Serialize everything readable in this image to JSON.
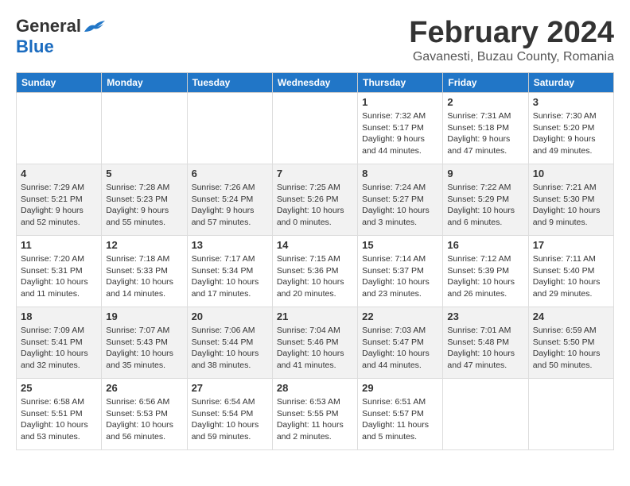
{
  "header": {
    "logo_general": "General",
    "logo_blue": "Blue",
    "month_title": "February 2024",
    "subtitle": "Gavanesti, Buzau County, Romania"
  },
  "weekdays": [
    "Sunday",
    "Monday",
    "Tuesday",
    "Wednesday",
    "Thursday",
    "Friday",
    "Saturday"
  ],
  "weeks": [
    [
      {
        "day": "",
        "sunrise": "",
        "sunset": "",
        "daylight": ""
      },
      {
        "day": "",
        "sunrise": "",
        "sunset": "",
        "daylight": ""
      },
      {
        "day": "",
        "sunrise": "",
        "sunset": "",
        "daylight": ""
      },
      {
        "day": "",
        "sunrise": "",
        "sunset": "",
        "daylight": ""
      },
      {
        "day": "1",
        "sunrise": "Sunrise: 7:32 AM",
        "sunset": "Sunset: 5:17 PM",
        "daylight": "Daylight: 9 hours and 44 minutes."
      },
      {
        "day": "2",
        "sunrise": "Sunrise: 7:31 AM",
        "sunset": "Sunset: 5:18 PM",
        "daylight": "Daylight: 9 hours and 47 minutes."
      },
      {
        "day": "3",
        "sunrise": "Sunrise: 7:30 AM",
        "sunset": "Sunset: 5:20 PM",
        "daylight": "Daylight: 9 hours and 49 minutes."
      }
    ],
    [
      {
        "day": "4",
        "sunrise": "Sunrise: 7:29 AM",
        "sunset": "Sunset: 5:21 PM",
        "daylight": "Daylight: 9 hours and 52 minutes."
      },
      {
        "day": "5",
        "sunrise": "Sunrise: 7:28 AM",
        "sunset": "Sunset: 5:23 PM",
        "daylight": "Daylight: 9 hours and 55 minutes."
      },
      {
        "day": "6",
        "sunrise": "Sunrise: 7:26 AM",
        "sunset": "Sunset: 5:24 PM",
        "daylight": "Daylight: 9 hours and 57 minutes."
      },
      {
        "day": "7",
        "sunrise": "Sunrise: 7:25 AM",
        "sunset": "Sunset: 5:26 PM",
        "daylight": "Daylight: 10 hours and 0 minutes."
      },
      {
        "day": "8",
        "sunrise": "Sunrise: 7:24 AM",
        "sunset": "Sunset: 5:27 PM",
        "daylight": "Daylight: 10 hours and 3 minutes."
      },
      {
        "day": "9",
        "sunrise": "Sunrise: 7:22 AM",
        "sunset": "Sunset: 5:29 PM",
        "daylight": "Daylight: 10 hours and 6 minutes."
      },
      {
        "day": "10",
        "sunrise": "Sunrise: 7:21 AM",
        "sunset": "Sunset: 5:30 PM",
        "daylight": "Daylight: 10 hours and 9 minutes."
      }
    ],
    [
      {
        "day": "11",
        "sunrise": "Sunrise: 7:20 AM",
        "sunset": "Sunset: 5:31 PM",
        "daylight": "Daylight: 10 hours and 11 minutes."
      },
      {
        "day": "12",
        "sunrise": "Sunrise: 7:18 AM",
        "sunset": "Sunset: 5:33 PM",
        "daylight": "Daylight: 10 hours and 14 minutes."
      },
      {
        "day": "13",
        "sunrise": "Sunrise: 7:17 AM",
        "sunset": "Sunset: 5:34 PM",
        "daylight": "Daylight: 10 hours and 17 minutes."
      },
      {
        "day": "14",
        "sunrise": "Sunrise: 7:15 AM",
        "sunset": "Sunset: 5:36 PM",
        "daylight": "Daylight: 10 hours and 20 minutes."
      },
      {
        "day": "15",
        "sunrise": "Sunrise: 7:14 AM",
        "sunset": "Sunset: 5:37 PM",
        "daylight": "Daylight: 10 hours and 23 minutes."
      },
      {
        "day": "16",
        "sunrise": "Sunrise: 7:12 AM",
        "sunset": "Sunset: 5:39 PM",
        "daylight": "Daylight: 10 hours and 26 minutes."
      },
      {
        "day": "17",
        "sunrise": "Sunrise: 7:11 AM",
        "sunset": "Sunset: 5:40 PM",
        "daylight": "Daylight: 10 hours and 29 minutes."
      }
    ],
    [
      {
        "day": "18",
        "sunrise": "Sunrise: 7:09 AM",
        "sunset": "Sunset: 5:41 PM",
        "daylight": "Daylight: 10 hours and 32 minutes."
      },
      {
        "day": "19",
        "sunrise": "Sunrise: 7:07 AM",
        "sunset": "Sunset: 5:43 PM",
        "daylight": "Daylight: 10 hours and 35 minutes."
      },
      {
        "day": "20",
        "sunrise": "Sunrise: 7:06 AM",
        "sunset": "Sunset: 5:44 PM",
        "daylight": "Daylight: 10 hours and 38 minutes."
      },
      {
        "day": "21",
        "sunrise": "Sunrise: 7:04 AM",
        "sunset": "Sunset: 5:46 PM",
        "daylight": "Daylight: 10 hours and 41 minutes."
      },
      {
        "day": "22",
        "sunrise": "Sunrise: 7:03 AM",
        "sunset": "Sunset: 5:47 PM",
        "daylight": "Daylight: 10 hours and 44 minutes."
      },
      {
        "day": "23",
        "sunrise": "Sunrise: 7:01 AM",
        "sunset": "Sunset: 5:48 PM",
        "daylight": "Daylight: 10 hours and 47 minutes."
      },
      {
        "day": "24",
        "sunrise": "Sunrise: 6:59 AM",
        "sunset": "Sunset: 5:50 PM",
        "daylight": "Daylight: 10 hours and 50 minutes."
      }
    ],
    [
      {
        "day": "25",
        "sunrise": "Sunrise: 6:58 AM",
        "sunset": "Sunset: 5:51 PM",
        "daylight": "Daylight: 10 hours and 53 minutes."
      },
      {
        "day": "26",
        "sunrise": "Sunrise: 6:56 AM",
        "sunset": "Sunset: 5:53 PM",
        "daylight": "Daylight: 10 hours and 56 minutes."
      },
      {
        "day": "27",
        "sunrise": "Sunrise: 6:54 AM",
        "sunset": "Sunset: 5:54 PM",
        "daylight": "Daylight: 10 hours and 59 minutes."
      },
      {
        "day": "28",
        "sunrise": "Sunrise: 6:53 AM",
        "sunset": "Sunset: 5:55 PM",
        "daylight": "Daylight: 11 hours and 2 minutes."
      },
      {
        "day": "29",
        "sunrise": "Sunrise: 6:51 AM",
        "sunset": "Sunset: 5:57 PM",
        "daylight": "Daylight: 11 hours and 5 minutes."
      },
      {
        "day": "",
        "sunrise": "",
        "sunset": "",
        "daylight": ""
      },
      {
        "day": "",
        "sunrise": "",
        "sunset": "",
        "daylight": ""
      }
    ]
  ]
}
